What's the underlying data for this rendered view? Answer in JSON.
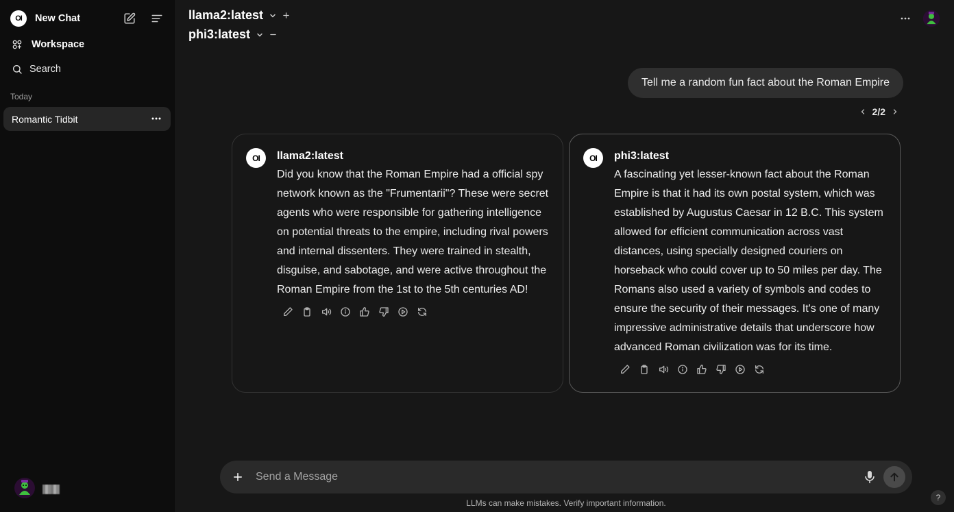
{
  "sidebar": {
    "logo_text": "OI",
    "new_chat_label": "New Chat",
    "workspace_label": "Workspace",
    "search_label": "Search",
    "section_title": "Today",
    "chats": [
      {
        "title": "Romantic Tidbit"
      }
    ],
    "chat_menu_icon": "more-horizontal-icon",
    "user_avatar_icon": "user-avatar-icon"
  },
  "header": {
    "models": [
      {
        "name": "llama2:latest",
        "action_icon": "plus-icon"
      },
      {
        "name": "phi3:latest",
        "action_icon": "minus-icon"
      }
    ],
    "menu_icon": "more-horizontal-icon",
    "profile_icon": "user-avatar-icon"
  },
  "conversation": {
    "user_message": "Tell me a random fun fact about the Roman Empire",
    "pager": "2/2",
    "responses": [
      {
        "avatar_text": "OI",
        "model": "llama2:latest",
        "text": "Did you know that the Roman Empire had a official spy network known as the \"Frumentarii\"? These were secret agents who were responsible for gathering intelligence on potential threats to the empire, including rival powers and internal dissenters. They were trained in stealth, disguise, and sabotage, and were active throughout the Roman Empire from the 1st to the 5th centuries AD!"
      },
      {
        "avatar_text": "OI",
        "model": "phi3:latest",
        "text": "A fascinating yet lesser-known fact about the Roman Empire is that it had its own postal system, which was established by Augustus Caesar in 12 B.C. This system allowed for efficient communication across vast distances, using specially designed couriers on horseback who could cover up to 50 miles per day. The Romans also used a variety of symbols and codes to ensure the security of their messages. It's one of many impressive administrative details that underscore how advanced Roman civilization was for its time."
      }
    ],
    "action_icons": [
      "edit-icon",
      "copy-icon",
      "read-aloud-icon",
      "info-icon",
      "thumbs-up-icon",
      "thumbs-down-icon",
      "continue-icon",
      "regenerate-icon"
    ]
  },
  "composer": {
    "placeholder": "Send a Message",
    "value": "",
    "disclaimer": "LLMs can make mistakes. Verify important information.",
    "help_label": "?"
  },
  "colors": {
    "background": "#171717",
    "sidebar": "#0d0d0d",
    "card_border": "#333333",
    "bubble": "#2f2f2f",
    "input": "#2a2a2a"
  }
}
